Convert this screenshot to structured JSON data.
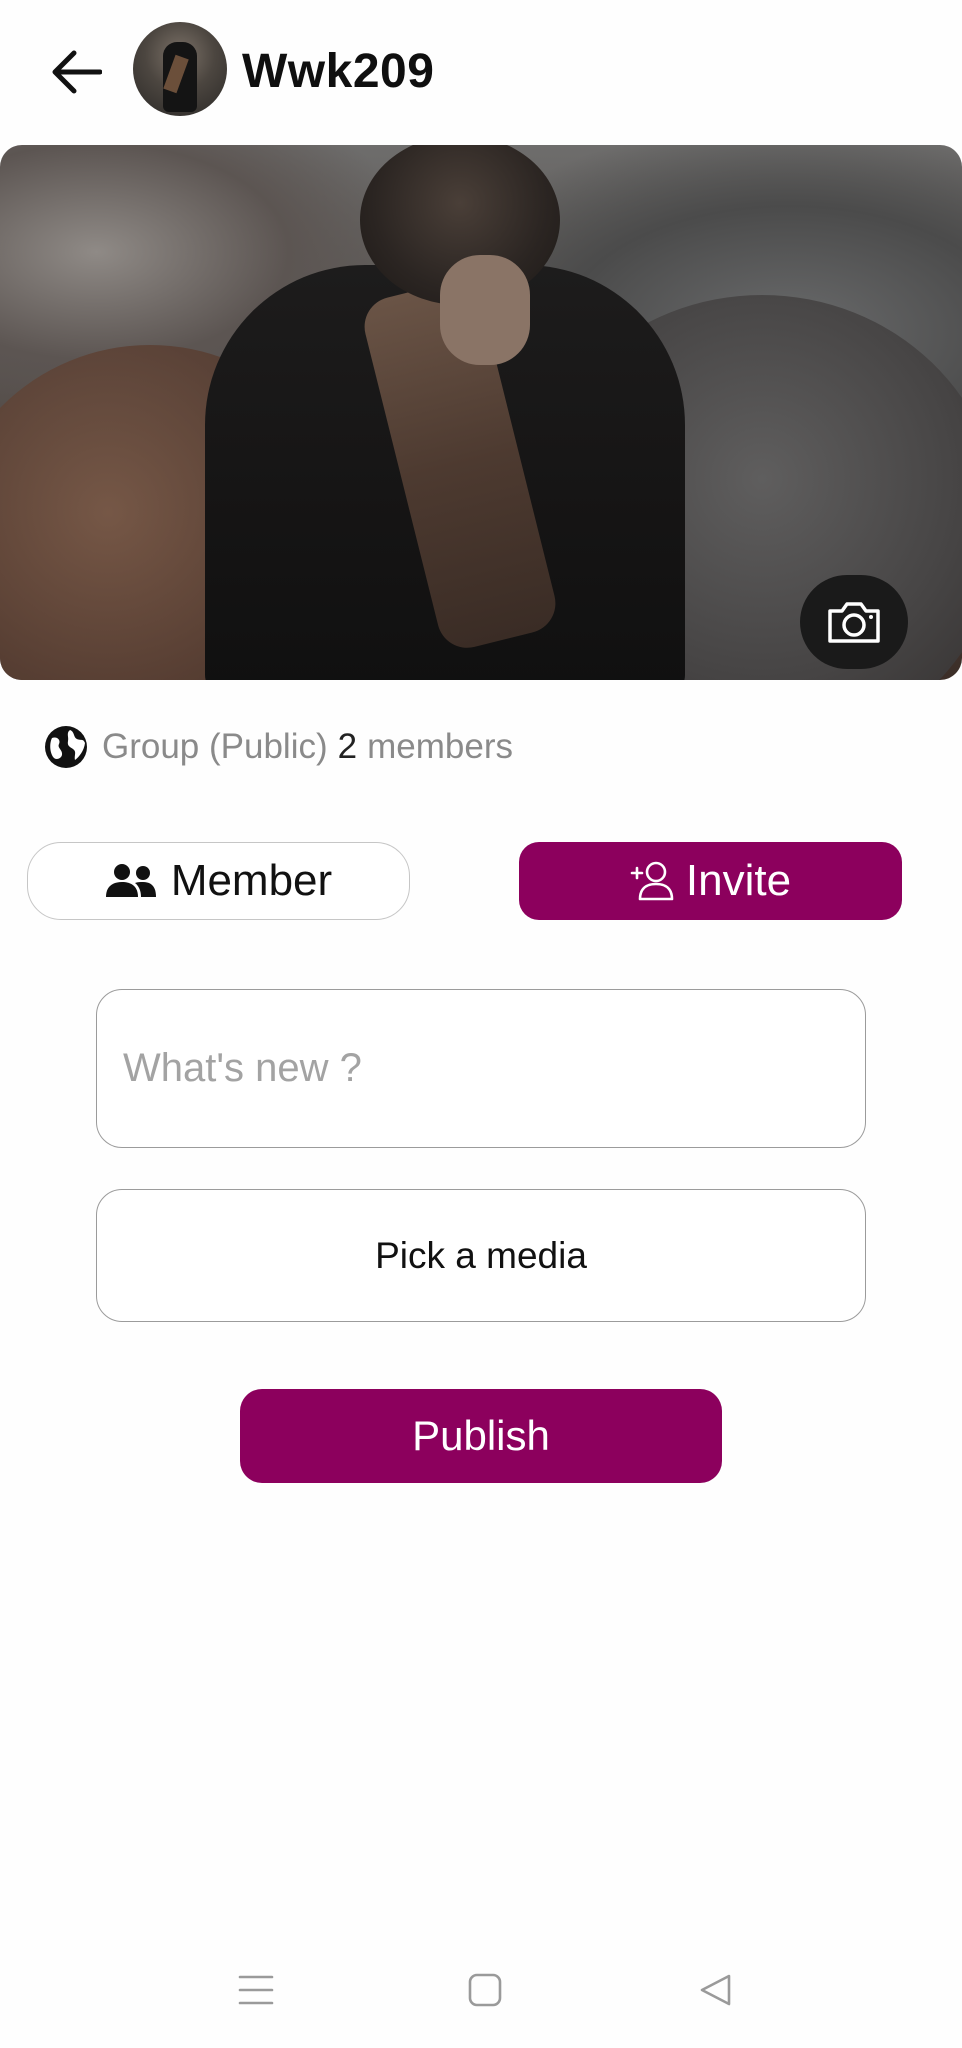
{
  "header": {
    "back_icon": "arrow-left-icon",
    "username": "Wwk209"
  },
  "cover": {
    "camera_icon": "camera-icon"
  },
  "group_info": {
    "globe_icon": "globe-icon",
    "type_label": "Group (Public)",
    "member_count": "2",
    "members_label": "members"
  },
  "actions": {
    "member_label": "Member",
    "member_icon": "people-icon",
    "invite_label": "Invite",
    "invite_icon": "add-person-icon"
  },
  "composer": {
    "placeholder": "What's new ?",
    "value": "",
    "pick_media_label": "Pick a media",
    "publish_label": "Publish"
  },
  "system_nav": {
    "items": [
      "menu-icon",
      "home-square-icon",
      "back-triangle-icon"
    ]
  },
  "colors": {
    "accent": "#8c005d",
    "muted_text": "#8a8a8a",
    "border": "#9b9b9b"
  }
}
